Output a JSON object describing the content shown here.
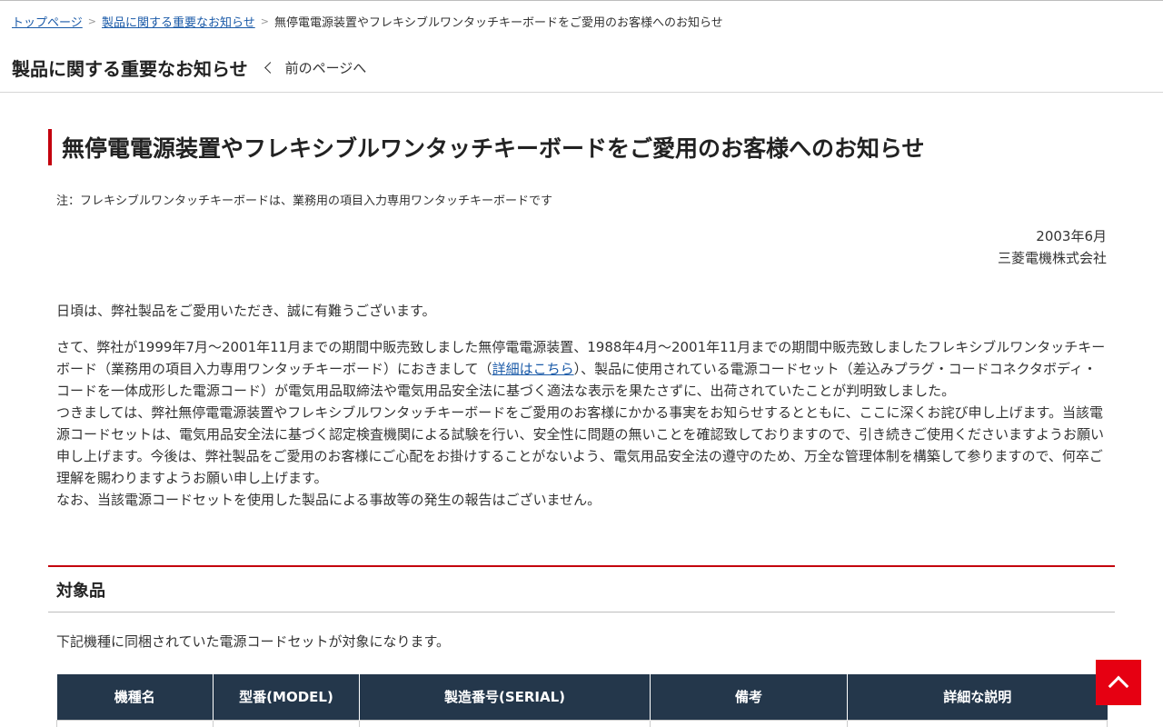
{
  "breadcrumb": {
    "items": [
      "トップページ",
      "製品に関する重要なお知らせ"
    ],
    "current": "無停電電源装置やフレキシブルワンタッチキーボードをご愛用のお客様へのお知らせ",
    "separator": ">"
  },
  "section": {
    "title": "製品に関する重要なお知らせ",
    "back_label": "前のページへ"
  },
  "page": {
    "heading": "無停電電源装置やフレキシブルワンタッチキーボードをご愛用のお客様へのお知らせ",
    "note": "注：フレキシブルワンタッチキーボードは、業務用の項目入力専用ワンタッチキーボードです",
    "date": "2003年6月",
    "company": "三菱電機株式会社",
    "greeting": "日頃は、弊社製品をご愛用いただき、誠に有難うございます。",
    "para1_before_link": "さて、弊社が1999年7月～2001年11月までの期間中販売致しました無停電電源装置、1988年4月～2001年11月までの期間中販売致しましたフレキシブルワンタッチキーボード（業務用の項目入力専用ワンタッチキーボード）におきまして（",
    "para1_link": "詳細はこちら",
    "para1_after_link": "）、製品に使用されている電源コードセット（差込みプラグ・コードコネクタボディ・コードを一体成形した電源コード）が電気用品取締法や電気用品安全法に基づく適法な表示を果たさずに、出荷されていたことが判明致しました。",
    "para2": "つきましては、弊社無停電電源装置やフレキシブルワンタッチキーボードをご愛用のお客様にかかる事実をお知らせするとともに、ここに深くお詫び申し上げます。当該電源コードセットは、電気用品安全法に基づく認定検査機関による試験を行い、安全性に問題の無いことを確認致しておりますので、引き続きご使用くださいますようお願い申し上げます。今後は、弊社製品をご愛用のお客様にご心配をお掛けすることがないよう、電気用品安全法の遵守のため、万全な管理体制を構築して参りますので、何卒ご理解を賜わりますようお願い申し上げます。",
    "para3": "なお、当該電源コードセットを使用した製品による事故等の発生の報告はございません。"
  },
  "targets": {
    "title": "対象品",
    "lead": "下記機種に同梱されていた電源コードセットが対象になります。",
    "columns": [
      "機種名",
      "型番(MODEL)",
      "製造番号(SERIAL)",
      "備考",
      "詳細な説明"
    ]
  },
  "colors": {
    "accent_red": "#c4000d",
    "table_header": "#24374b",
    "link": "#1a5aa8",
    "to_top_button": "#e60012"
  },
  "icons": {
    "back": "chevron-left-icon",
    "to_top": "chevron-up-icon"
  }
}
